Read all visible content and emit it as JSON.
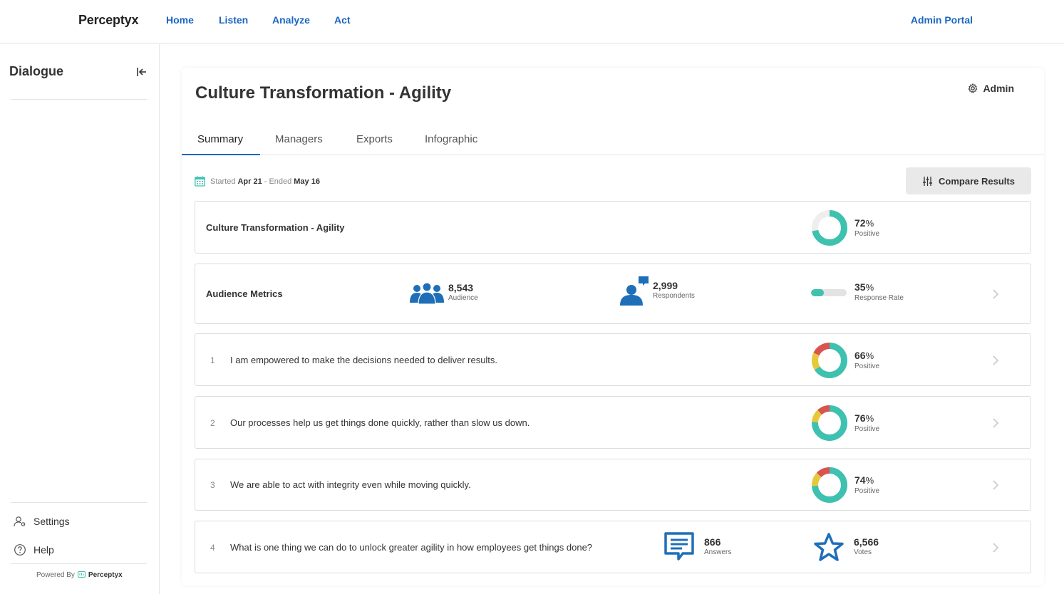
{
  "nav": {
    "brand": "Perceptyx",
    "links": [
      "Home",
      "Listen",
      "Analyze",
      "Act"
    ],
    "admin_portal": "Admin Portal"
  },
  "sidebar": {
    "title": "Dialogue",
    "settings": "Settings",
    "help": "Help",
    "powered_by": "Powered By",
    "powered_brand": "Perceptyx"
  },
  "page": {
    "title": "Culture Transformation - Agility",
    "admin_label": "Admin",
    "tabs": [
      "Summary",
      "Managers",
      "Exports",
      "Infographic"
    ],
    "started_label": "Started",
    "started_date": "Apr 21",
    "ended_label": "- Ended",
    "ended_date": "May 16",
    "compare_button": "Compare Results"
  },
  "overall": {
    "title": "Culture Transformation - Agility",
    "value": "72",
    "unit": "%",
    "label": "Positive"
  },
  "audience": {
    "title": "Audience Metrics",
    "audience_value": "8,543",
    "audience_label": "Audience",
    "respondents_value": "2,999",
    "respondents_label": "Respondents",
    "rate_value": "35",
    "rate_unit": "%",
    "rate_label": "Response Rate",
    "rate_fraction": 0.35
  },
  "questions": [
    {
      "num": "1",
      "text": "I am empowered to make the decisions needed to deliver results.",
      "value": "66",
      "unit": "%",
      "label": "Positive",
      "pos": 66,
      "neu": 16,
      "neg": 18
    },
    {
      "num": "2",
      "text": "Our processes help us get things done quickly, rather than slow us down.",
      "value": "76",
      "unit": "%",
      "label": "Positive",
      "pos": 76,
      "neu": 12,
      "neg": 12
    },
    {
      "num": "3",
      "text": "We are able to act with integrity even while moving quickly.",
      "value": "74",
      "unit": "%",
      "label": "Positive",
      "pos": 74,
      "neu": 13,
      "neg": 13
    }
  ],
  "open_question": {
    "num": "4",
    "text": "What is one thing we can do to unlock greater agility in how employees get things done?",
    "answers_value": "866",
    "answers_label": "Answers",
    "votes_value": "6,566",
    "votes_label": "Votes"
  },
  "colors": {
    "positive": "#3fc1b0",
    "neutral": "#e6c93a",
    "negative": "#d9534f",
    "track": "#eeeeee",
    "accent": "#1a66c2",
    "icon_blue": "#1e6fb8"
  }
}
